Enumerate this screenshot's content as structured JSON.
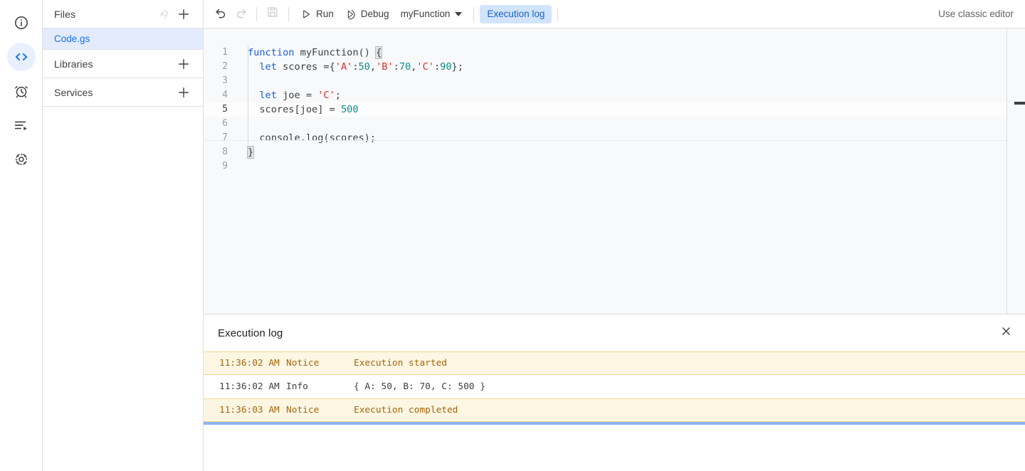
{
  "rail": {
    "items": [
      {
        "name": "project-overview",
        "icon": "info-icon",
        "active": false
      },
      {
        "name": "editor",
        "icon": "code-icon",
        "active": true
      },
      {
        "name": "triggers",
        "icon": "alarm-clock-icon",
        "active": false
      },
      {
        "name": "executions",
        "icon": "executions-list-icon",
        "active": false
      },
      {
        "name": "project-settings",
        "icon": "gear-icon",
        "active": false
      }
    ]
  },
  "files_panel": {
    "files_header": {
      "title": "Files",
      "sort_icon": "sort-az-icon",
      "add_icon": "plus-icon"
    },
    "files": [
      {
        "name": "Code.gs",
        "selected": true
      }
    ],
    "libraries_header": {
      "title": "Libraries",
      "add_icon": "plus-icon"
    },
    "services_header": {
      "title": "Services",
      "add_icon": "plus-icon"
    }
  },
  "toolbar": {
    "undo_icon": "undo-icon",
    "redo_icon": "redo-icon",
    "save_icon": "save-icon",
    "run_label": "Run",
    "run_icon": "play-icon",
    "debug_label": "Debug",
    "debug_icon": "debug-icon",
    "function_select_value": "myFunction",
    "execution_log_label": "Execution log",
    "classic_editor_label": "Use classic editor"
  },
  "editor": {
    "lines": [
      {
        "number": "1",
        "tokens": [
          {
            "t": "function",
            "c": "kw"
          },
          {
            "t": " myFunction() ",
            "c": "pln"
          },
          {
            "t": "{",
            "c": "brk"
          }
        ]
      },
      {
        "number": "2",
        "tokens": [
          {
            "t": "  ",
            "c": "pln"
          },
          {
            "t": "let",
            "c": "kw"
          },
          {
            "t": " scores ={",
            "c": "pln"
          },
          {
            "t": "'A'",
            "c": "str"
          },
          {
            "t": ":",
            "c": "pln"
          },
          {
            "t": "50",
            "c": "num"
          },
          {
            "t": ",",
            "c": "pln"
          },
          {
            "t": "'B'",
            "c": "str"
          },
          {
            "t": ":",
            "c": "pln"
          },
          {
            "t": "70",
            "c": "num"
          },
          {
            "t": ",",
            "c": "pln"
          },
          {
            "t": "'C'",
            "c": "str"
          },
          {
            "t": ":",
            "c": "pln"
          },
          {
            "t": "90",
            "c": "num"
          },
          {
            "t": "};",
            "c": "pln"
          }
        ]
      },
      {
        "number": "3",
        "tokens": []
      },
      {
        "number": "4",
        "tokens": [
          {
            "t": "  ",
            "c": "pln"
          },
          {
            "t": "let",
            "c": "kw"
          },
          {
            "t": " joe = ",
            "c": "pln"
          },
          {
            "t": "'C'",
            "c": "str"
          },
          {
            "t": ";",
            "c": "pln"
          }
        ]
      },
      {
        "number": "5",
        "active": true,
        "tokens": [
          {
            "t": "  scores[joe] = ",
            "c": "pln"
          },
          {
            "t": "500",
            "c": "num"
          }
        ]
      },
      {
        "number": "6",
        "tokens": []
      },
      {
        "number": "7",
        "tokens": [
          {
            "t": "  console.log(scores);",
            "c": "pln"
          }
        ]
      },
      {
        "number": "8",
        "tokens": [
          {
            "t": "}",
            "c": "brk"
          }
        ]
      },
      {
        "number": "9",
        "tokens": []
      }
    ]
  },
  "execution_log": {
    "title": "Execution log",
    "close_icon": "close-icon",
    "columns": [
      "time",
      "level",
      "message"
    ],
    "rows": [
      {
        "time": "11:36:02 AM",
        "level": "Notice",
        "message": "Execution started",
        "type": "notice"
      },
      {
        "time": "11:36:02 AM",
        "level": "Info",
        "message": "{ A: 50, B: 70, C: 500 }",
        "type": "info"
      },
      {
        "time": "11:36:03 AM",
        "level": "Notice",
        "message": "Execution completed",
        "type": "notice"
      }
    ]
  },
  "colors": {
    "accent_blue": "#1a73e8",
    "chip_bg": "#d2e3fc",
    "selected_file_bg": "#e3ebfd",
    "notice_bg": "#fdf6e3",
    "notice_text": "#a5660b",
    "progress_bar": "#8ab4f8",
    "editor_bg": "#f8f9fa",
    "keyword": "#1b5ed6",
    "string": "#d32f2f",
    "number": "#0d8a8a"
  }
}
